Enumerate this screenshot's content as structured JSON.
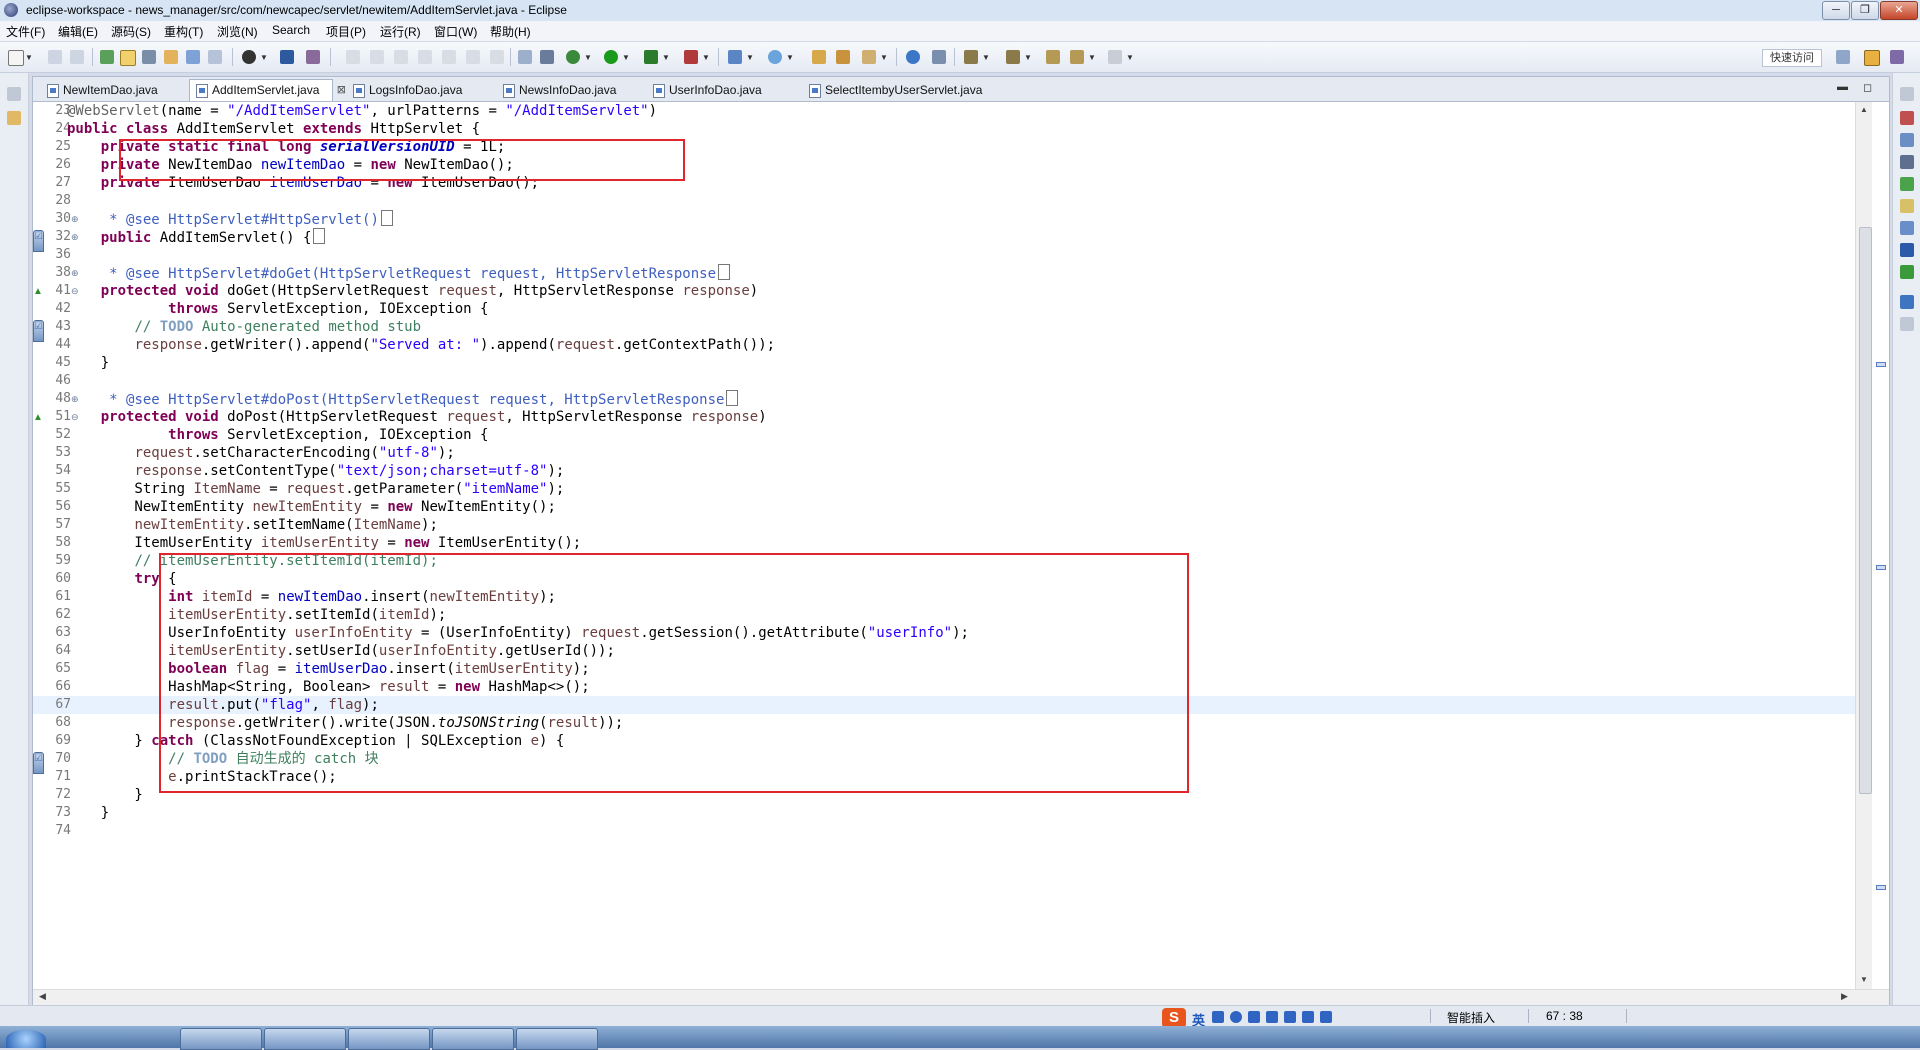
{
  "window": {
    "title": "eclipse-workspace - news_manager/src/com/newcapec/servlet/newitem/AddItemServlet.java - Eclipse"
  },
  "menu": [
    "文件(F)",
    "编辑(E)",
    "源码(S)",
    "重构(T)",
    "浏览(N)",
    "Search",
    "项目(P)",
    "运行(R)",
    "窗口(W)",
    "帮助(H)"
  ],
  "toolbar": {
    "quick_access": "快速访问"
  },
  "tabs": [
    {
      "label": "NewItemDao.java",
      "active": false
    },
    {
      "label": "AddItemServlet.java",
      "active": true
    },
    {
      "label": "LogsInfoDao.java",
      "active": false
    },
    {
      "label": "NewsInfoDao.java",
      "active": false
    },
    {
      "label": "UserInfoDao.java",
      "active": false
    },
    {
      "label": "SelectItembyUserServlet.java",
      "active": false
    }
  ],
  "status": {
    "insert_mode": "智能插入",
    "cursor": "67 : 38",
    "ime_lang": "英"
  },
  "code_lines": [
    {
      "n": "23",
      "segs": [
        [
          "an",
          "@WebServlet"
        ],
        [
          "p",
          "(name = "
        ],
        [
          "s",
          "\"/AddItemServlet\""
        ],
        [
          "p",
          ", urlPatterns = "
        ],
        [
          "s",
          "\"/AddItemServlet\""
        ],
        [
          "p",
          ")"
        ]
      ]
    },
    {
      "n": "24",
      "segs": [
        [
          "k",
          "public class"
        ],
        [
          "p",
          " AddItemServlet "
        ],
        [
          "k",
          "extends"
        ],
        [
          "p",
          " HttpServlet {"
        ]
      ]
    },
    {
      "n": "25",
      "segs": [
        [
          "p",
          "    "
        ],
        [
          "k",
          "private static final long"
        ],
        [
          "p",
          " "
        ],
        [
          "sfi",
          "serialVersionUID"
        ],
        [
          "p",
          " = 1L;"
        ]
      ]
    },
    {
      "n": "26",
      "segs": [
        [
          "p",
          "    "
        ],
        [
          "k",
          "private"
        ],
        [
          "p",
          " NewItemDao "
        ],
        [
          "f",
          "newItemDao"
        ],
        [
          "p",
          " = "
        ],
        [
          "k",
          "new"
        ],
        [
          "p",
          " NewItemDao();"
        ]
      ]
    },
    {
      "n": "27",
      "segs": [
        [
          "p",
          "    "
        ],
        [
          "k",
          "private"
        ],
        [
          "p",
          " ItemUserDao "
        ],
        [
          "f",
          "itemUserDao"
        ],
        [
          "p",
          " = "
        ],
        [
          "k",
          "new"
        ],
        [
          "p",
          " ItemUserDao();"
        ]
      ]
    },
    {
      "n": "28",
      "segs": []
    },
    {
      "n": "30",
      "fold": "⊕",
      "segs": [
        [
          "p",
          "     "
        ],
        [
          "cd",
          "* @see HttpServlet#HttpServlet()"
        ]
      ],
      "box": true
    },
    {
      "n": "32",
      "fold": "⊕",
      "mark": "task",
      "segs": [
        [
          "p",
          "    "
        ],
        [
          "k",
          "public"
        ],
        [
          "p",
          " AddItemServlet() {"
        ]
      ],
      "box": true
    },
    {
      "n": "36",
      "segs": []
    },
    {
      "n": "38",
      "fold": "⊕",
      "segs": [
        [
          "p",
          "     "
        ],
        [
          "cd",
          "* @see HttpServlet#doGet(HttpServletRequest request, HttpServletResponse"
        ]
      ],
      "box": true
    },
    {
      "n": "41",
      "fold": "⊖",
      "mark": "up",
      "segs": [
        [
          "p",
          "    "
        ],
        [
          "k",
          "protected void"
        ],
        [
          "p",
          " doGet(HttpServletRequest "
        ],
        [
          "lv",
          "request"
        ],
        [
          "p",
          ", HttpServletResponse "
        ],
        [
          "lv",
          "response"
        ],
        [
          "p",
          ")"
        ]
      ]
    },
    {
      "n": "42",
      "segs": [
        [
          "p",
          "            "
        ],
        [
          "k",
          "throws"
        ],
        [
          "p",
          " ServletException, IOException {"
        ]
      ]
    },
    {
      "n": "43",
      "mark": "task",
      "segs": [
        [
          "p",
          "        "
        ],
        [
          "c",
          "// "
        ],
        [
          "ct",
          "TODO"
        ],
        [
          "c",
          " Auto-generated method stub"
        ]
      ]
    },
    {
      "n": "44",
      "segs": [
        [
          "p",
          "        "
        ],
        [
          "lv",
          "response"
        ],
        [
          "p",
          ".getWriter().append("
        ],
        [
          "s",
          "\"Served at: \""
        ],
        [
          "p",
          ").append("
        ],
        [
          "lv",
          "request"
        ],
        [
          "p",
          ".getContextPath());"
        ]
      ]
    },
    {
      "n": "45",
      "segs": [
        [
          "p",
          "    }"
        ]
      ]
    },
    {
      "n": "46",
      "segs": []
    },
    {
      "n": "48",
      "fold": "⊕",
      "segs": [
        [
          "p",
          "     "
        ],
        [
          "cd",
          "* @see HttpServlet#doPost(HttpServletRequest request, HttpServletResponse"
        ]
      ],
      "box": true
    },
    {
      "n": "51",
      "fold": "⊖",
      "mark": "up",
      "segs": [
        [
          "p",
          "    "
        ],
        [
          "k",
          "protected void"
        ],
        [
          "p",
          " doPost(HttpServletRequest "
        ],
        [
          "lv",
          "request"
        ],
        [
          "p",
          ", HttpServletResponse "
        ],
        [
          "lv",
          "response"
        ],
        [
          "p",
          ")"
        ]
      ]
    },
    {
      "n": "52",
      "segs": [
        [
          "p",
          "            "
        ],
        [
          "k",
          "throws"
        ],
        [
          "p",
          " ServletException, IOException {"
        ]
      ]
    },
    {
      "n": "53",
      "segs": [
        [
          "p",
          "        "
        ],
        [
          "lv",
          "request"
        ],
        [
          "p",
          ".setCharacterEncoding("
        ],
        [
          "s",
          "\"utf-8\""
        ],
        [
          "p",
          ");"
        ]
      ]
    },
    {
      "n": "54",
      "segs": [
        [
          "p",
          "        "
        ],
        [
          "lv",
          "response"
        ],
        [
          "p",
          ".setContentType("
        ],
        [
          "s",
          "\"text/json;charset=utf-8\""
        ],
        [
          "p",
          ");"
        ]
      ]
    },
    {
      "n": "55",
      "segs": [
        [
          "p",
          "        String "
        ],
        [
          "lv",
          "ItemName"
        ],
        [
          "p",
          " = "
        ],
        [
          "lv",
          "request"
        ],
        [
          "p",
          ".getParameter("
        ],
        [
          "s",
          "\"itemName\""
        ],
        [
          "p",
          ");"
        ]
      ]
    },
    {
      "n": "56",
      "segs": [
        [
          "p",
          "        NewItemEntity "
        ],
        [
          "lv",
          "newItemEntity"
        ],
        [
          "p",
          " = "
        ],
        [
          "k",
          "new"
        ],
        [
          "p",
          " NewItemEntity();"
        ]
      ]
    },
    {
      "n": "57",
      "segs": [
        [
          "p",
          "        "
        ],
        [
          "lv",
          "newItemEntity"
        ],
        [
          "p",
          ".setItemName("
        ],
        [
          "lv",
          "ItemName"
        ],
        [
          "p",
          ");"
        ]
      ]
    },
    {
      "n": "58",
      "segs": [
        [
          "p",
          "        ItemUserEntity "
        ],
        [
          "lv",
          "itemUserEntity"
        ],
        [
          "p",
          " = "
        ],
        [
          "k",
          "new"
        ],
        [
          "p",
          " ItemUserEntity();"
        ]
      ]
    },
    {
      "n": "59",
      "segs": [
        [
          "p",
          "        "
        ],
        [
          "c",
          "// itemUserEntity.setItemId(itemId);"
        ]
      ]
    },
    {
      "n": "60",
      "segs": [
        [
          "p",
          "        "
        ],
        [
          "k",
          "try"
        ],
        [
          "p",
          " {"
        ]
      ]
    },
    {
      "n": "61",
      "segs": [
        [
          "p",
          "            "
        ],
        [
          "k",
          "int"
        ],
        [
          "p",
          " "
        ],
        [
          "lv",
          "itemId"
        ],
        [
          "p",
          " = "
        ],
        [
          "f",
          "newItemDao"
        ],
        [
          "p",
          ".insert("
        ],
        [
          "lv",
          "newItemEntity"
        ],
        [
          "p",
          ");"
        ]
      ]
    },
    {
      "n": "62",
      "segs": [
        [
          "p",
          "            "
        ],
        [
          "lv",
          "itemUserEntity"
        ],
        [
          "p",
          ".setItemId("
        ],
        [
          "lv",
          "itemId"
        ],
        [
          "p",
          ");"
        ]
      ]
    },
    {
      "n": "63",
      "segs": [
        [
          "p",
          "            UserInfoEntity "
        ],
        [
          "lv",
          "userInfoEntity"
        ],
        [
          "p",
          " = (UserInfoEntity) "
        ],
        [
          "lv",
          "request"
        ],
        [
          "p",
          ".getSession().getAttribute("
        ],
        [
          "s",
          "\"userInfo\""
        ],
        [
          "p",
          ");"
        ]
      ]
    },
    {
      "n": "64",
      "segs": [
        [
          "p",
          "            "
        ],
        [
          "lv",
          "itemUserEntity"
        ],
        [
          "p",
          ".setUserId("
        ],
        [
          "lv",
          "userInfoEntity"
        ],
        [
          "p",
          ".getUserId());"
        ]
      ]
    },
    {
      "n": "65",
      "segs": [
        [
          "p",
          "            "
        ],
        [
          "k",
          "boolean"
        ],
        [
          "p",
          " "
        ],
        [
          "lv",
          "flag"
        ],
        [
          "p",
          " = "
        ],
        [
          "f",
          "itemUserDao"
        ],
        [
          "p",
          ".insert("
        ],
        [
          "lv",
          "itemUserEntity"
        ],
        [
          "p",
          ");"
        ]
      ]
    },
    {
      "n": "66",
      "segs": [
        [
          "p",
          "            HashMap<String, Boolean> "
        ],
        [
          "lv",
          "result"
        ],
        [
          "p",
          " = "
        ],
        [
          "k",
          "new"
        ],
        [
          "p",
          " HashMap<>();"
        ]
      ]
    },
    {
      "n": "67",
      "current": true,
      "segs": [
        [
          "p",
          "            "
        ],
        [
          "lv",
          "result"
        ],
        [
          "p",
          ".put("
        ],
        [
          "s",
          "\"flag\""
        ],
        [
          "p",
          ", "
        ],
        [
          "lv",
          "flag"
        ],
        [
          "p",
          ");"
        ]
      ]
    },
    {
      "n": "68",
      "segs": [
        [
          "p",
          "            "
        ],
        [
          "lv",
          "response"
        ],
        [
          "p",
          ".getWriter().write(JSON."
        ],
        [
          "si",
          "toJSONString"
        ],
        [
          "p",
          "("
        ],
        [
          "lv",
          "result"
        ],
        [
          "p",
          "));"
        ]
      ]
    },
    {
      "n": "69",
      "segs": [
        [
          "p",
          "        } "
        ],
        [
          "k",
          "catch"
        ],
        [
          "p",
          " (ClassNotFoundException | SQLException "
        ],
        [
          "lv",
          "e"
        ],
        [
          "p",
          ") {"
        ]
      ]
    },
    {
      "n": "70",
      "mark": "task",
      "segs": [
        [
          "p",
          "            "
        ],
        [
          "c",
          "// "
        ],
        [
          "ct",
          "TODO"
        ],
        [
          "c",
          " 自动生成的 catch 块"
        ]
      ]
    },
    {
      "n": "71",
      "segs": [
        [
          "p",
          "            "
        ],
        [
          "lv",
          "e"
        ],
        [
          "p",
          ".printStackTrace();"
        ]
      ]
    },
    {
      "n": "72",
      "segs": [
        [
          "p",
          "        }"
        ]
      ]
    },
    {
      "n": "73",
      "segs": [
        [
          "p",
          "    }"
        ]
      ]
    },
    {
      "n": "74",
      "segs": []
    }
  ]
}
